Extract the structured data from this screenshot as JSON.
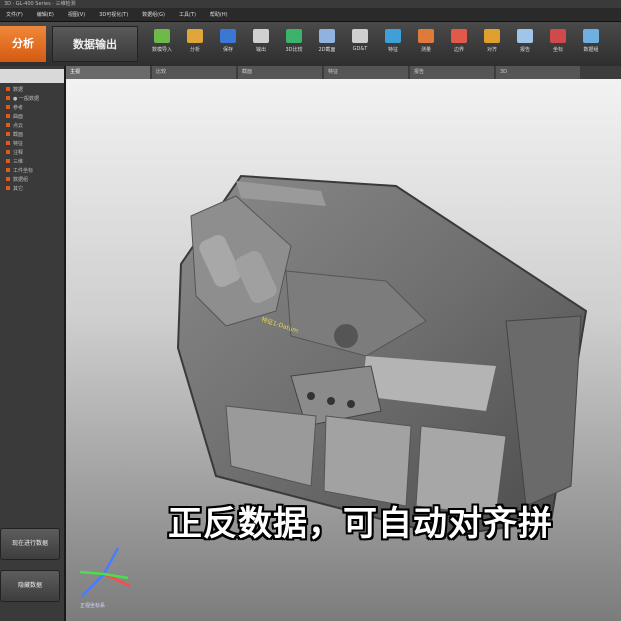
{
  "window": {
    "title": "3D · GL-400 Series · 三维检测"
  },
  "menu": {
    "items": [
      "文件(F)",
      "编辑(E)",
      "视图(V)",
      "3D可视化(T)",
      "数据组(G)",
      "工具(T)",
      "帮助(H)"
    ]
  },
  "ribbon": {
    "tabs": [
      {
        "label": "分析",
        "active": true
      },
      {
        "label": "数据输出",
        "active": false
      }
    ],
    "tools": [
      {
        "label": "数模导入",
        "icon": "import-icon",
        "color": "#6fb84a"
      },
      {
        "label": "分析",
        "icon": "analysis-icon",
        "color": "#e0a63a"
      },
      {
        "label": "保存",
        "icon": "save-icon",
        "color": "#3a78d6"
      },
      {
        "label": "输出",
        "icon": "export-icon",
        "color": "#d0d0d0"
      },
      {
        "label": "3D比较",
        "icon": "compare-icon",
        "color": "#3bb36a"
      },
      {
        "label": "2D截面",
        "icon": "section-icon",
        "color": "#8fb3e0"
      },
      {
        "label": "GD&T",
        "icon": "gdt-icon",
        "color": "#cfcfcf"
      },
      {
        "label": "特征",
        "icon": "feature-icon",
        "color": "#3fa0d8"
      },
      {
        "label": "测量",
        "icon": "measure-icon",
        "color": "#e07a3a"
      },
      {
        "label": "边界",
        "icon": "boundary-icon",
        "color": "#e05a4a"
      },
      {
        "label": "对齐",
        "icon": "align-icon",
        "color": "#e0a030"
      },
      {
        "label": "报告",
        "icon": "report-icon",
        "color": "#9fc6ea"
      },
      {
        "label": "坐标",
        "icon": "axis-icon",
        "color": "#d04a4a"
      },
      {
        "label": "数据组",
        "icon": "group-icon",
        "color": "#6fb0e0"
      }
    ]
  },
  "sidebar": {
    "items": [
      "数据",
      "● 一般数据",
      "参考",
      "曲面",
      "点云",
      "截面",
      "特征",
      "注释",
      "三维",
      "工件坐标",
      "数据组",
      "其它"
    ],
    "buttons": [
      "现在进行数据",
      "隐藏数据"
    ]
  },
  "viewport": {
    "tabs": [
      {
        "label": "主视",
        "active": true
      },
      {
        "label": "比较",
        "active": false
      },
      {
        "label": "截面",
        "active": false
      },
      {
        "label": "特征",
        "active": false
      },
      {
        "label": "报告",
        "active": false
      },
      {
        "label": "3D",
        "active": false
      }
    ],
    "triad_label": "正视坐标系",
    "part_label": "特征1-Datum"
  },
  "caption": {
    "text": "正反数据，可自动对齐拼"
  },
  "colors": {
    "accent": "#e8782a",
    "subtitle": "#ffffff"
  }
}
